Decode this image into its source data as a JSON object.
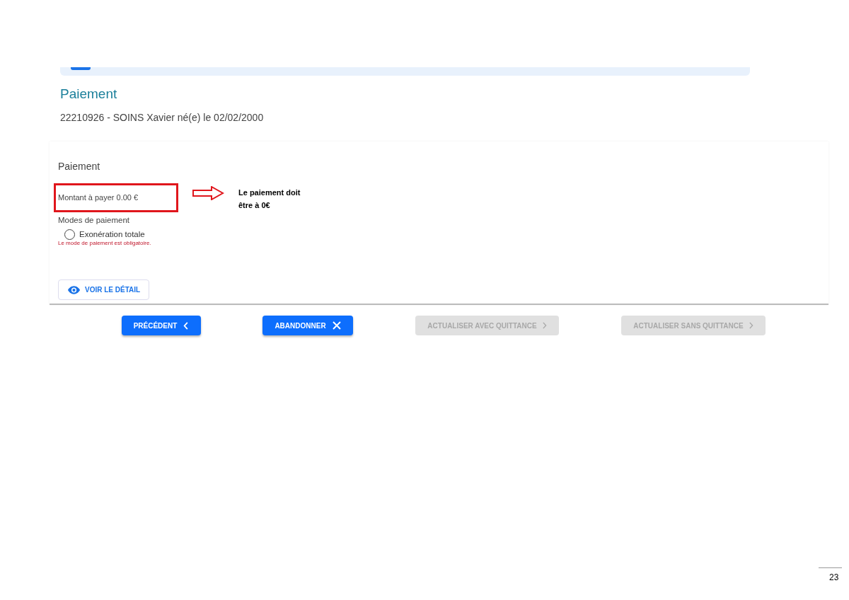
{
  "page": {
    "title": "Paiement",
    "patient": "22210926 - SOINS Xavier né(e) le 02/02/2000"
  },
  "card": {
    "title": "Paiement",
    "amount": "Montant à payer 0.00 €",
    "modes_label": "Modes de paiement",
    "options": [
      {
        "label": "Exonération totale",
        "selected": false
      }
    ],
    "error": "Le mode de paiement est obligatoire.",
    "detail_button": "VOIR LE DÉTAIL"
  },
  "annotation": {
    "note_lines": [
      "Le paiement doit",
      "être à 0€"
    ]
  },
  "buttons": [
    {
      "label": "PRÉCÉDENT",
      "kind": "back",
      "disabled": false
    },
    {
      "label": "ABANDONNER",
      "kind": "cancel",
      "disabled": false
    },
    {
      "label": "ACTUALISER AVEC QUITTANCE",
      "kind": "next",
      "disabled": true
    },
    {
      "label": "ACTUALISER SANS QUITTANCE",
      "kind": "next",
      "disabled": true
    }
  ],
  "page_number": "23"
}
